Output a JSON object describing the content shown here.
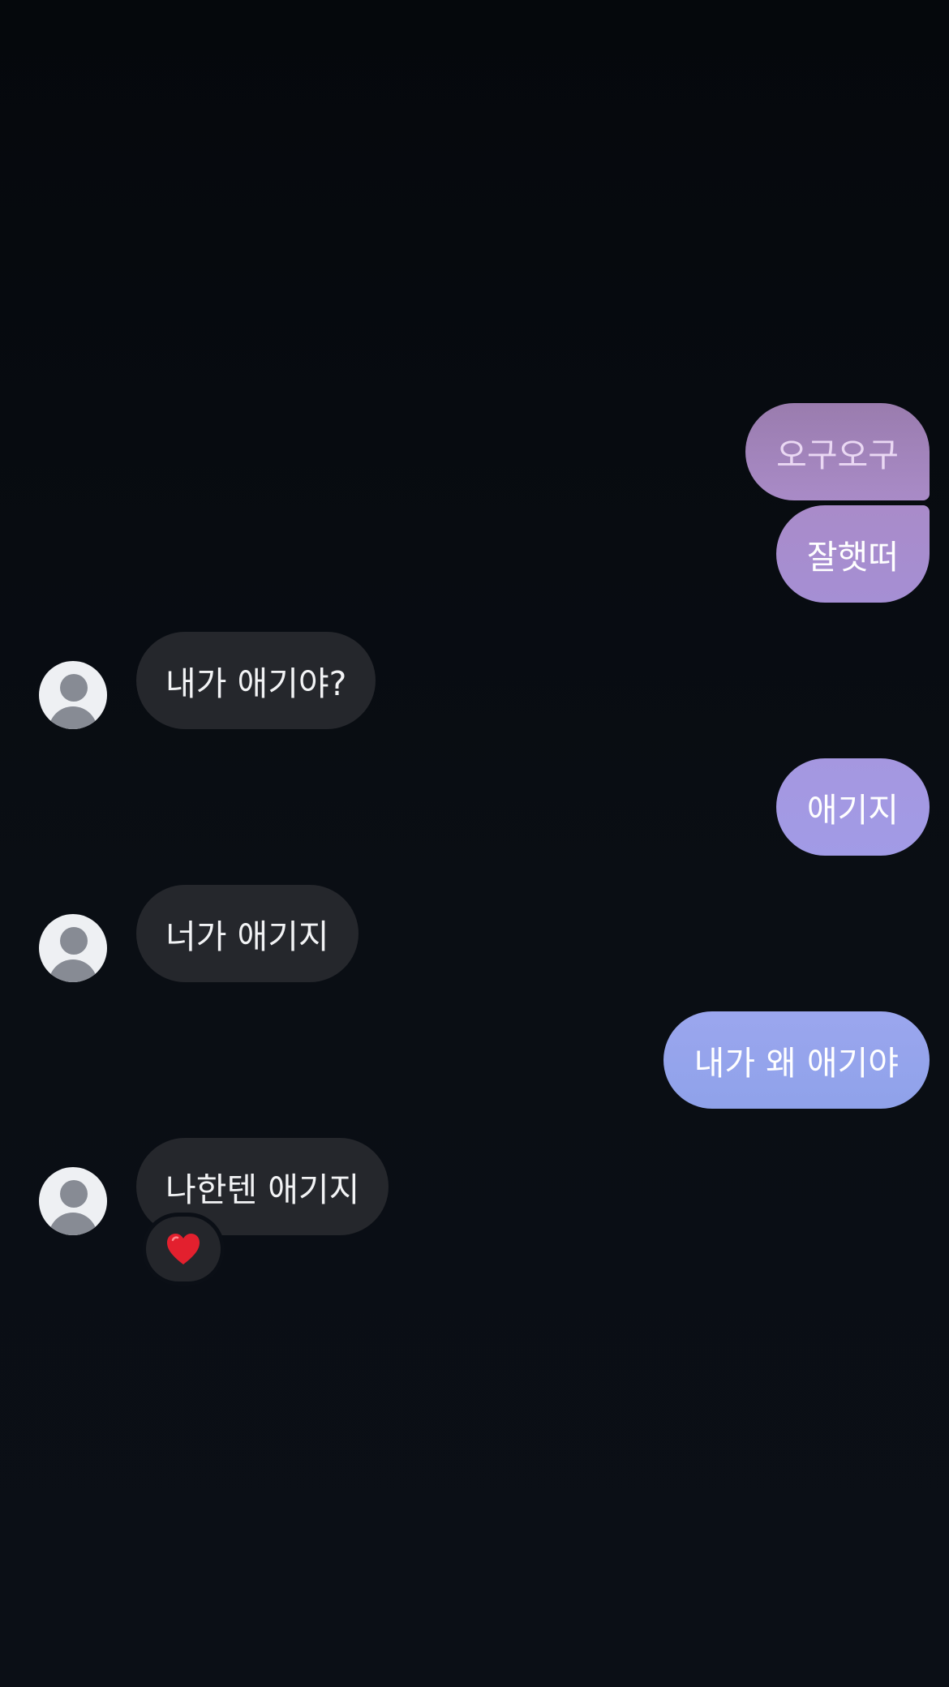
{
  "conversation": {
    "messages": [
      {
        "direction": "outgoing",
        "text": "오구오구"
      },
      {
        "direction": "outgoing",
        "text": "잘햇떠"
      },
      {
        "direction": "incoming",
        "text": "내가 애기야?"
      },
      {
        "direction": "outgoing",
        "text": "애기지"
      },
      {
        "direction": "incoming",
        "text": "너가 애기지"
      },
      {
        "direction": "outgoing",
        "text": "내가 왜 애기야"
      },
      {
        "direction": "incoming",
        "text": "나한텐 애기지",
        "reaction": "heart-icon"
      }
    ]
  },
  "colors": {
    "background": "#0a0e14",
    "incoming_bubble": "#25272c",
    "outgoing_gradient_top": "#a282bd",
    "outgoing_gradient_bottom": "#8fa2ea",
    "reaction_heart": "#e3202e"
  }
}
